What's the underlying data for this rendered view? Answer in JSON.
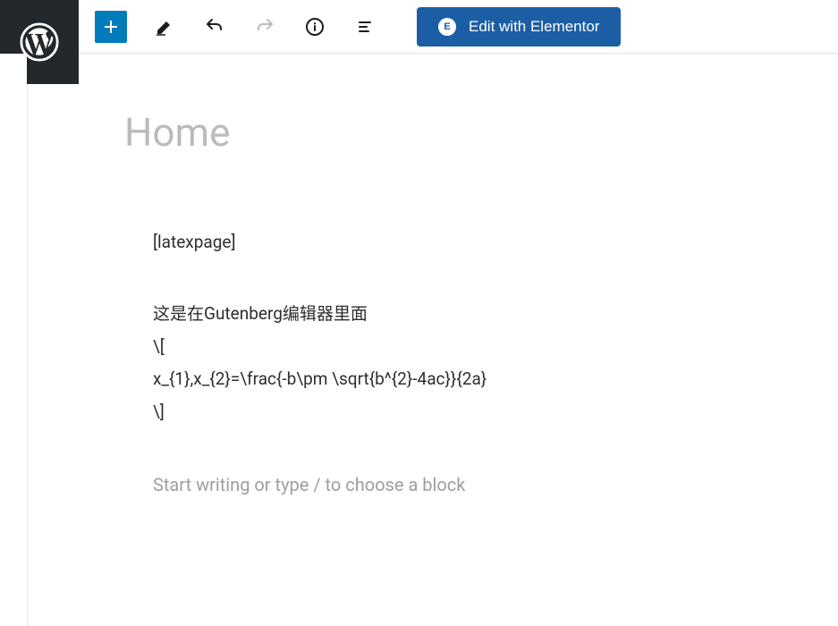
{
  "toolbar": {
    "add_label": "Add block",
    "edit_label": "Edit",
    "undo_label": "Undo",
    "redo_label": "Redo",
    "info_label": "Details",
    "outline_label": "Outline"
  },
  "elementor": {
    "button_label": "Edit with Elementor"
  },
  "editor": {
    "title_placeholder": "Home",
    "blocks": [
      "[latexpage]",
      "",
      "这是在Gutenberg编辑器里面",
      "\\[",
      "x_{1},x_{2}=\\frac{-b\\pm \\sqrt{b^{2}-4ac}}{2a}",
      "\\]"
    ],
    "new_block_placeholder": "Start writing or type / to choose a block"
  }
}
